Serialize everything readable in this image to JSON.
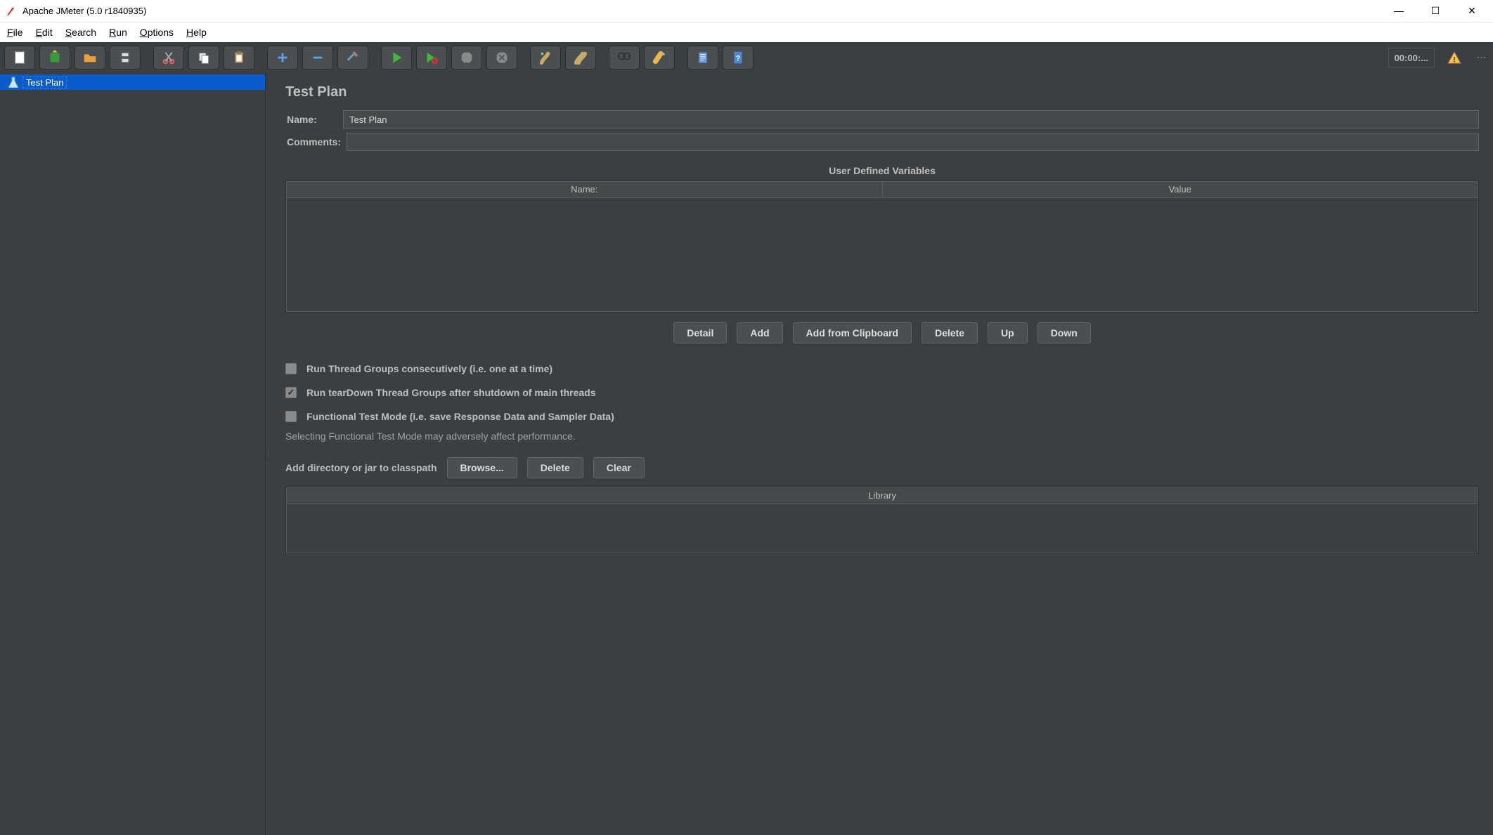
{
  "window": {
    "title": "Apache JMeter (5.0 r1840935)"
  },
  "menu": {
    "file": "File",
    "edit": "Edit",
    "search": "Search",
    "run": "Run",
    "options": "Options",
    "help": "Help"
  },
  "toolbar": {
    "new": "new-icon",
    "templates": "templates-icon",
    "open": "open-icon",
    "save": "save-icon",
    "cut": "cut-icon",
    "copy": "copy-icon",
    "paste": "paste-icon",
    "plus": "plus-icon",
    "minus": "minus-icon",
    "toggle": "toggle-icon",
    "start": "start-icon",
    "start_no_timers": "start-no-timers-icon",
    "stop": "stop-icon",
    "shutdown": "shutdown-icon",
    "clear": "clear-icon",
    "clear_all": "clear-all-icon",
    "search_tb": "search-icon",
    "reset_search": "reset-search-icon",
    "fn_helper": "function-helper-icon",
    "help_tb": "help-icon",
    "timer": "00:00:..."
  },
  "tree": {
    "root": "Test Plan"
  },
  "panel": {
    "heading": "Test Plan",
    "name_label": "Name:",
    "name_value": "Test Plan",
    "comments_label": "Comments:",
    "comments_value": "",
    "udv_title": "User Defined Variables",
    "col_name": "Name:",
    "col_value": "Value",
    "buttons": {
      "detail": "Detail",
      "add": "Add",
      "add_clipboard": "Add from Clipboard",
      "delete": "Delete",
      "up": "Up",
      "down": "Down"
    },
    "check_consecutive": "Run Thread Groups consecutively (i.e. one at a time)",
    "check_teardown": "Run tearDown Thread Groups after shutdown of main threads",
    "check_functional": "Functional Test Mode (i.e. save Response Data and Sampler Data)",
    "functional_note": "Selecting Functional Test Mode may adversely affect performance.",
    "classpath_label": "Add directory or jar to classpath",
    "browse": "Browse...",
    "cp_delete": "Delete",
    "cp_clear": "Clear",
    "library_header": "Library"
  }
}
